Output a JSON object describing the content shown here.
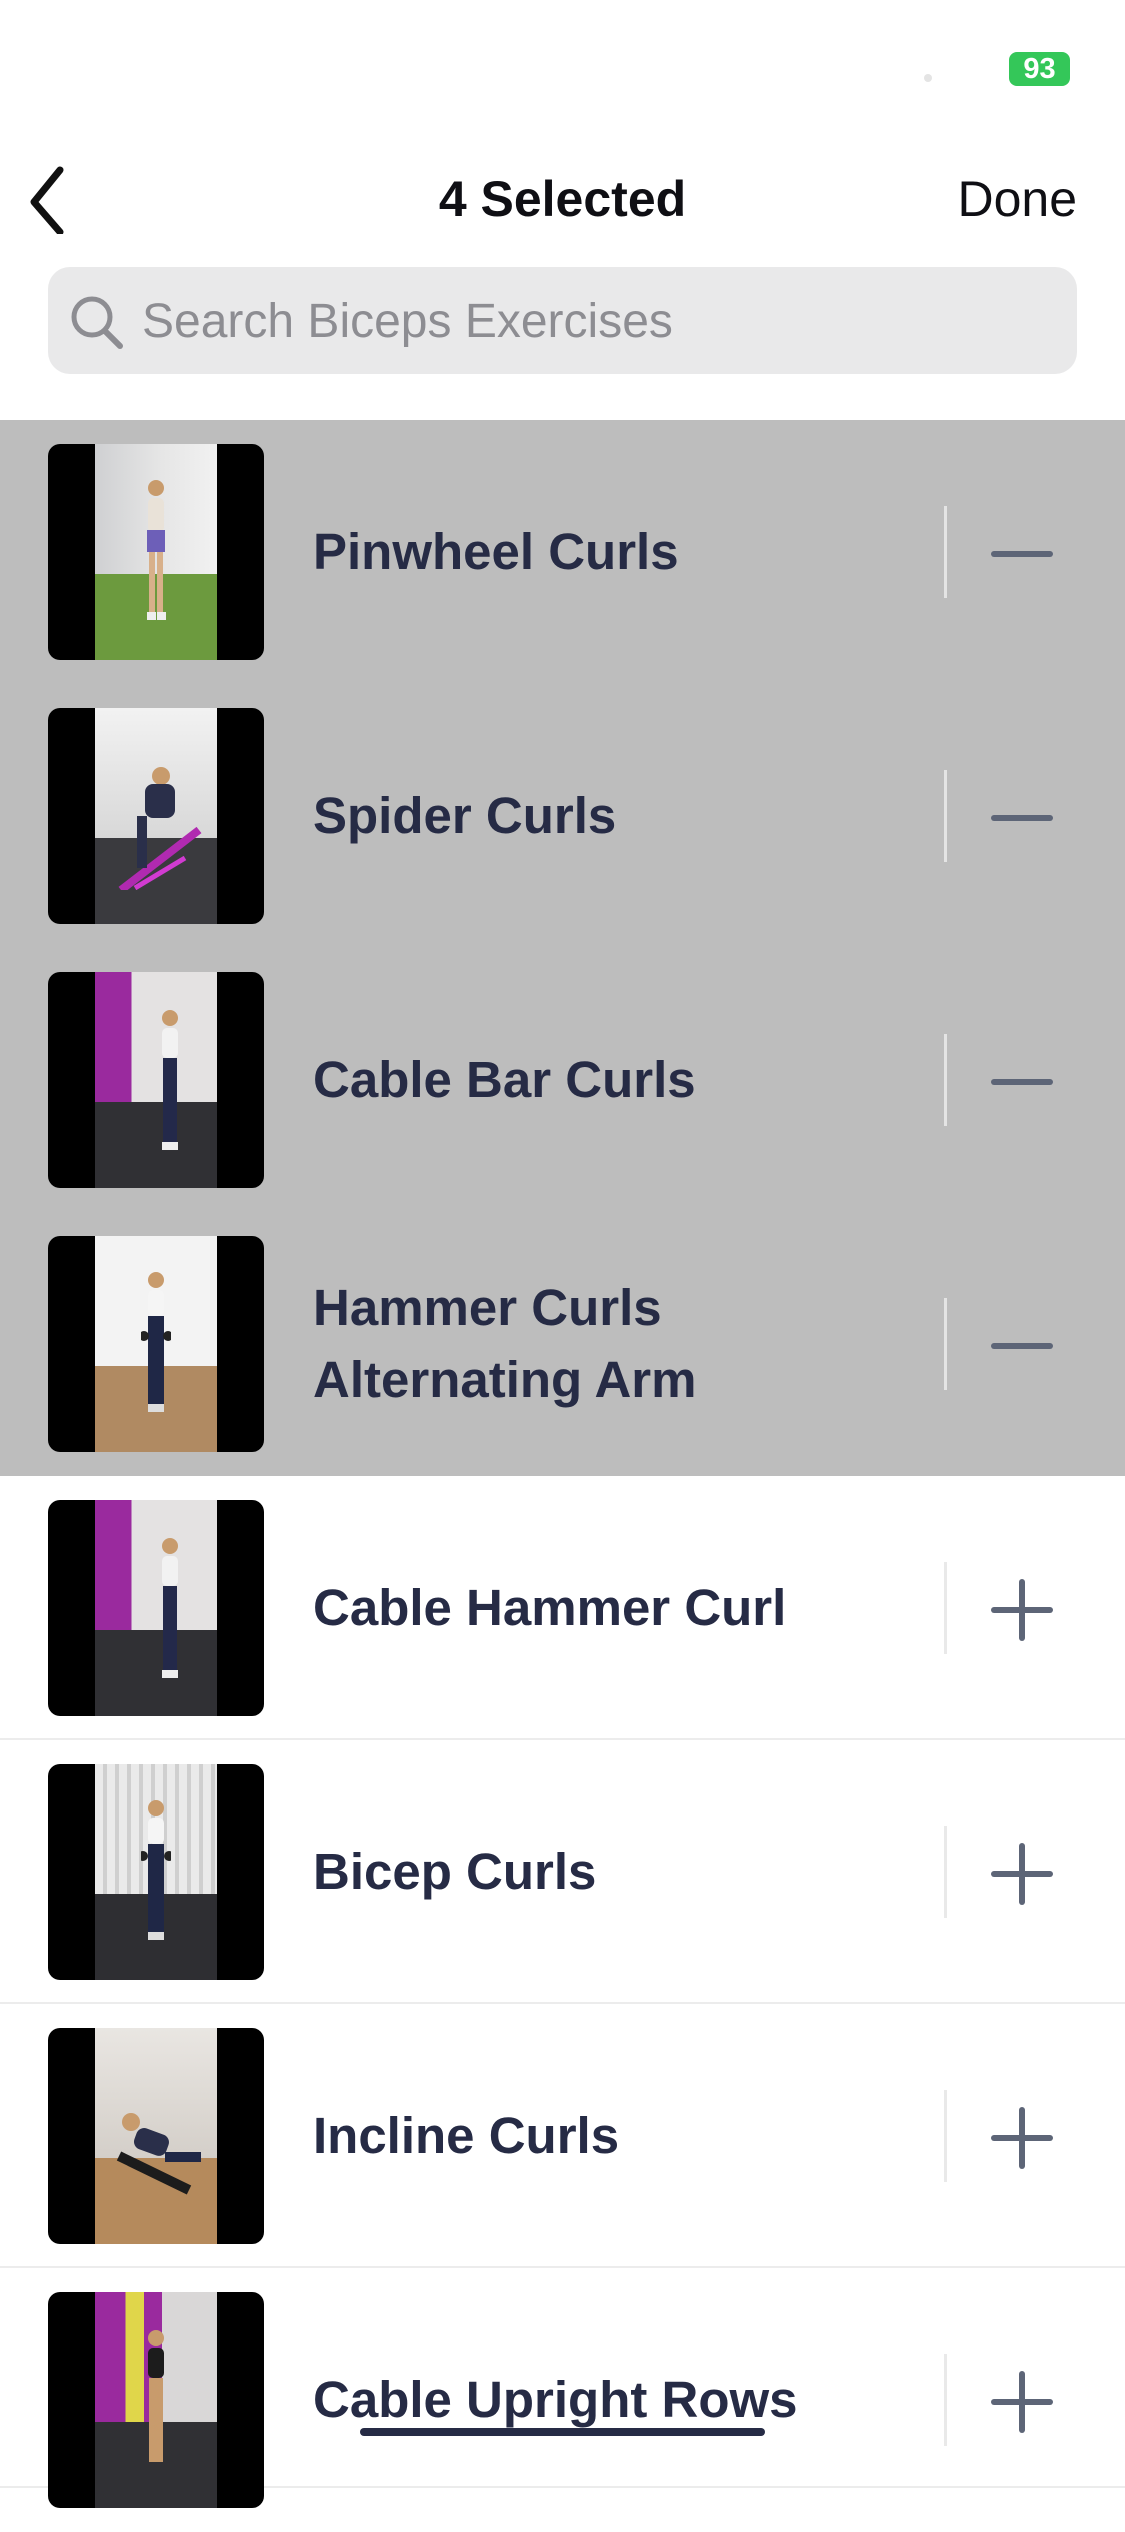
{
  "status_bar": {
    "battery": "93"
  },
  "nav": {
    "title": "4 Selected",
    "done_label": "Done"
  },
  "search": {
    "placeholder": "Search Biceps Exercises",
    "value": ""
  },
  "exercises": [
    {
      "name": "Pinwheel Curls",
      "selected": true,
      "action": "remove"
    },
    {
      "name": "Spider Curls",
      "selected": true,
      "action": "remove"
    },
    {
      "name": "Cable Bar Curls",
      "selected": true,
      "action": "remove"
    },
    {
      "name": "Hammer Curls Alternating Arm",
      "selected": true,
      "action": "remove"
    },
    {
      "name": "Cable Hammer Curl",
      "selected": false,
      "action": "add"
    },
    {
      "name": "Bicep Curls",
      "selected": false,
      "action": "add"
    },
    {
      "name": "Incline Curls",
      "selected": false,
      "action": "add"
    },
    {
      "name": "Cable Upright Rows",
      "selected": false,
      "action": "add"
    }
  ],
  "icons": {
    "back": "chevron-left-icon",
    "search": "magnifier-icon",
    "remove": "minus-icon",
    "add": "plus-icon"
  },
  "colors": {
    "selected_row_bg": "#bdbdbd",
    "text_dark": "#262b45",
    "icon_gray": "#5d6577",
    "battery_green": "#34c759"
  }
}
